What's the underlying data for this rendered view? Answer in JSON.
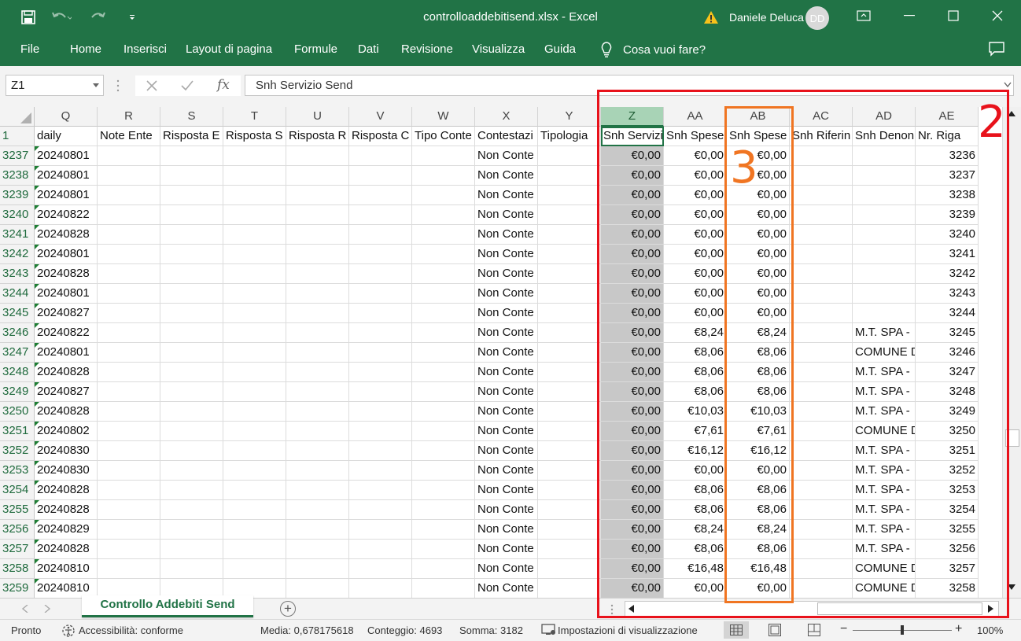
{
  "window": {
    "title": "controlloaddebitisend.xlsx  -  Excel",
    "user_name": "Daniele Deluca",
    "user_initials": "DD"
  },
  "ribbon": {
    "tabs": [
      "File",
      "Home",
      "Inserisci",
      "Layout di pagina",
      "Formule",
      "Dati",
      "Revisione",
      "Visualizza",
      "Guida"
    ],
    "tell_me": "Cosa vuoi fare?"
  },
  "formula_bar": {
    "name_box": "Z1",
    "formula": "Snh Servizio Send",
    "fx_label": "fx"
  },
  "columns": [
    "Q",
    "R",
    "S",
    "T",
    "U",
    "V",
    "W",
    "X",
    "Y",
    "Z",
    "AA",
    "AB",
    "AC",
    "AD",
    "AE"
  ],
  "header_row": {
    "row_number": "1",
    "cells": [
      "daily",
      "Note Ente",
      "Risposta E",
      "Risposta S",
      "Risposta R",
      "Risposta C",
      "Tipo Conte",
      "Contestazi",
      "Tipologia",
      "Snh Servizi",
      "Snh Spese",
      "Snh Spese",
      "Snh Riferin",
      "Snh Denon",
      "Nr. Riga"
    ]
  },
  "rows": [
    {
      "n": "3237",
      "q": "20240801",
      "x": "Non Conte",
      "z": "€0,00",
      "aa": "€0,00",
      "ab": "€0,00",
      "ad": "",
      "ae": "3236"
    },
    {
      "n": "3238",
      "q": "20240801",
      "x": "Non Conte",
      "z": "€0,00",
      "aa": "€0,00",
      "ab": "€0,00",
      "ad": "",
      "ae": "3237"
    },
    {
      "n": "3239",
      "q": "20240801",
      "x": "Non Conte",
      "z": "€0,00",
      "aa": "€0,00",
      "ab": "€0,00",
      "ad": "",
      "ae": "3238"
    },
    {
      "n": "3240",
      "q": "20240822",
      "x": "Non Conte",
      "z": "€0,00",
      "aa": "€0,00",
      "ab": "€0,00",
      "ad": "",
      "ae": "3239"
    },
    {
      "n": "3241",
      "q": "20240828",
      "x": "Non Conte",
      "z": "€0,00",
      "aa": "€0,00",
      "ab": "€0,00",
      "ad": "",
      "ae": "3240"
    },
    {
      "n": "3242",
      "q": "20240801",
      "x": "Non Conte",
      "z": "€0,00",
      "aa": "€0,00",
      "ab": "€0,00",
      "ad": "",
      "ae": "3241"
    },
    {
      "n": "3243",
      "q": "20240828",
      "x": "Non Conte",
      "z": "€0,00",
      "aa": "€0,00",
      "ab": "€0,00",
      "ad": "",
      "ae": "3242"
    },
    {
      "n": "3244",
      "q": "20240801",
      "x": "Non Conte",
      "z": "€0,00",
      "aa": "€0,00",
      "ab": "€0,00",
      "ad": "",
      "ae": "3243"
    },
    {
      "n": "3245",
      "q": "20240827",
      "x": "Non Conte",
      "z": "€0,00",
      "aa": "€0,00",
      "ab": "€0,00",
      "ad": "",
      "ae": "3244"
    },
    {
      "n": "3246",
      "q": "20240822",
      "x": "Non Conte",
      "z": "€0,00",
      "aa": "€8,24",
      "ab": "€8,24",
      "ad": "M.T. SPA -",
      "ae": "3245"
    },
    {
      "n": "3247",
      "q": "20240801",
      "x": "Non Conte",
      "z": "€0,00",
      "aa": "€8,06",
      "ab": "€8,06",
      "ad": "COMUNE D",
      "ae": "3246"
    },
    {
      "n": "3248",
      "q": "20240828",
      "x": "Non Conte",
      "z": "€0,00",
      "aa": "€8,06",
      "ab": "€8,06",
      "ad": "M.T. SPA -",
      "ae": "3247"
    },
    {
      "n": "3249",
      "q": "20240827",
      "x": "Non Conte",
      "z": "€0,00",
      "aa": "€8,06",
      "ab": "€8,06",
      "ad": "M.T. SPA -",
      "ae": "3248"
    },
    {
      "n": "3250",
      "q": "20240828",
      "x": "Non Conte",
      "z": "€0,00",
      "aa": "€10,03",
      "ab": "€10,03",
      "ad": "M.T. SPA -",
      "ae": "3249"
    },
    {
      "n": "3251",
      "q": "20240802",
      "x": "Non Conte",
      "z": "€0,00",
      "aa": "€7,61",
      "ab": "€7,61",
      "ad": "COMUNE D",
      "ae": "3250"
    },
    {
      "n": "3252",
      "q": "20240830",
      "x": "Non Conte",
      "z": "€0,00",
      "aa": "€16,12",
      "ab": "€16,12",
      "ad": "M.T. SPA -",
      "ae": "3251"
    },
    {
      "n": "3253",
      "q": "20240830",
      "x": "Non Conte",
      "z": "€0,00",
      "aa": "€0,00",
      "ab": "€0,00",
      "ad": "M.T. SPA -",
      "ae": "3252"
    },
    {
      "n": "3254",
      "q": "20240828",
      "x": "Non Conte",
      "z": "€0,00",
      "aa": "€8,06",
      "ab": "€8,06",
      "ad": "M.T. SPA -",
      "ae": "3253"
    },
    {
      "n": "3255",
      "q": "20240828",
      "x": "Non Conte",
      "z": "€0,00",
      "aa": "€8,06",
      "ab": "€8,06",
      "ad": "M.T. SPA -",
      "ae": "3254"
    },
    {
      "n": "3256",
      "q": "20240829",
      "x": "Non Conte",
      "z": "€0,00",
      "aa": "€8,24",
      "ab": "€8,24",
      "ad": "M.T. SPA -",
      "ae": "3255"
    },
    {
      "n": "3257",
      "q": "20240828",
      "x": "Non Conte",
      "z": "€0,00",
      "aa": "€8,06",
      "ab": "€8,06",
      "ad": "M.T. SPA -",
      "ae": "3256"
    },
    {
      "n": "3258",
      "q": "20240810",
      "x": "Non Conte",
      "z": "€0,00",
      "aa": "€16,48",
      "ab": "€16,48",
      "ad": "COMUNE D",
      "ae": "3257"
    },
    {
      "n": "3259",
      "q": "20240810",
      "x": "Non Conte",
      "z": "€0,00",
      "aa": "€0,00",
      "ab": "€0,00",
      "ad": "COMUNE D",
      "ae": "3258"
    }
  ],
  "sheet": {
    "tab_name": "Controllo Addebiti Send",
    "add_sheet": "+"
  },
  "status": {
    "ready": "Pronto",
    "accessibility": "Accessibilità: conforme",
    "average": "Media: 0,678175618",
    "count": "Conteggio: 4693",
    "sum": "Somma: 3182",
    "display_settings": "Impostazioni di visualizzazione",
    "zoom_out": "−",
    "zoom_in": "+",
    "zoom": "100%",
    "zoom_level_fraction": 0.5
  },
  "annotations": {
    "label_2": "2",
    "label_3": "3",
    "red_color": "#e8121b",
    "orange_color": "#f07522"
  },
  "colors": {
    "excel_green": "#217346",
    "selected_column": "#c8c8c8"
  }
}
